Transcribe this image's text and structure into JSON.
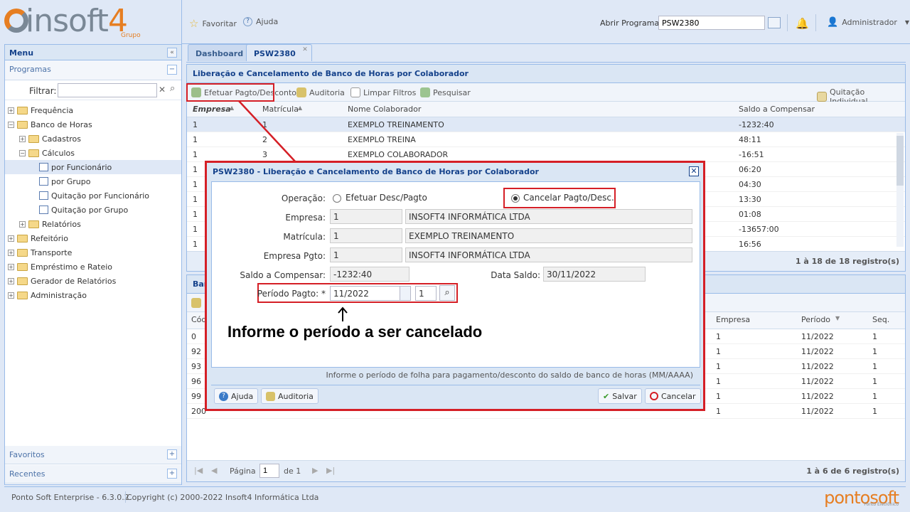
{
  "header": {
    "logo_text": "insoft",
    "logo_digit": "4",
    "logo_sub": "Grupo",
    "favorite_label": "Favoritar",
    "help_label": "Ajuda",
    "program_label": "Abrir Programa:",
    "program_value": "PSW2380",
    "user_label": "Administrador"
  },
  "sidebar": {
    "menu_title": "Menu",
    "programs_title": "Programas",
    "filter_label": "Filtrar:",
    "items": [
      {
        "label": "Frequência"
      },
      {
        "label": "Banco de Horas"
      },
      {
        "label": "Cadastros"
      },
      {
        "label": "Cálculos"
      },
      {
        "label": "por Funcionário"
      },
      {
        "label": "por Grupo"
      },
      {
        "label": "Quitação por Funcionário"
      },
      {
        "label": "Quitação por Grupo"
      },
      {
        "label": "Relatórios"
      },
      {
        "label": "Refeitório"
      },
      {
        "label": "Transporte"
      },
      {
        "label": "Empréstimo e Rateio"
      },
      {
        "label": "Gerador de Relatórios"
      },
      {
        "label": "Administração"
      }
    ],
    "favorites_title": "Favoritos",
    "recent_title": "Recentes"
  },
  "tabs": [
    {
      "label": "Dashboard"
    },
    {
      "label": "PSW2380"
    }
  ],
  "grid1": {
    "title": "Liberação e Cancelamento de Banco de Horas por Colaborador",
    "toolbar": {
      "pay": "Efetuar Pagto/Desconto",
      "audit": "Auditoria",
      "clear": "Limpar Filtros",
      "search": "Pesquisar",
      "individual": "Quitação Individual"
    },
    "columns": [
      "Empresa",
      "Matrícula",
      "Nome Colaborador",
      "Saldo a Compensar"
    ],
    "rows": [
      {
        "c1": "1",
        "c2": "1",
        "c3": "EXEMPLO TREINAMENTO",
        "c4": "-1232:40"
      },
      {
        "c1": "1",
        "c2": "2",
        "c3": "EXEMPLO TREINA",
        "c4": "48:11"
      },
      {
        "c1": "1",
        "c2": "3",
        "c3": "EXEMPLO COLABORADOR",
        "c4": "-16:51"
      },
      {
        "c1": "1",
        "c2": "",
        "c3": "",
        "c4": "06:20"
      },
      {
        "c1": "1",
        "c2": "",
        "c3": "",
        "c4": "04:30"
      },
      {
        "c1": "1",
        "c2": "",
        "c3": "",
        "c4": "13:30"
      },
      {
        "c1": "1",
        "c2": "",
        "c3": "",
        "c4": "01:08"
      },
      {
        "c1": "1",
        "c2": "",
        "c3": "",
        "c4": "-13657:00"
      },
      {
        "c1": "1",
        "c2": "",
        "c3": "",
        "c4": "16:56"
      }
    ],
    "pager_info": "1 à 18 de 18 registro(s)"
  },
  "grid2": {
    "title_prefix": "Ban",
    "columns": [
      "Cód",
      "Empresa",
      "Período",
      "Seq."
    ],
    "rows": [
      {
        "c1": "0",
        "c2": "1",
        "c3": "11/2022",
        "c4": "1"
      },
      {
        "c1": "92",
        "c2": "1",
        "c3": "11/2022",
        "c4": "1"
      },
      {
        "c1": "93",
        "c2": "1",
        "c3": "11/2022",
        "c4": "1"
      },
      {
        "c1": "96",
        "c2": "1",
        "c3": "11/2022",
        "c4": "1"
      },
      {
        "c1": "99",
        "c2": "1",
        "c3": "11/2022",
        "c4": "1"
      },
      {
        "c1": "200",
        "c2": "1",
        "c3": "11/2022",
        "c4": "1"
      }
    ],
    "page_label": "Página",
    "page_value": "1",
    "page_of": "de 1",
    "pager_info": "1 à 6 de 6 registro(s)"
  },
  "modal": {
    "title": "PSW2380 - Liberação e Cancelamento de Banco de Horas por Colaborador",
    "operation_label": "Operação:",
    "op1": "Efetuar Desc/Pagto",
    "op2": "Cancelar Pagto/Desc.",
    "empresa_label": "Empresa:",
    "empresa_code": "1",
    "empresa_name": "INSOFT4 INFORMÁTICA LTDA",
    "matricula_label": "Matrícula:",
    "matricula_code": "1",
    "matricula_name": "EXEMPLO TREINAMENTO",
    "empresa_pgto_label": "Empresa Pgto:",
    "empresa_pgto_code": "1",
    "empresa_pgto_name": "INSOFT4 INFORMÁTICA LTDA",
    "saldo_label": "Saldo a Compensar:",
    "saldo_value": "-1232:40",
    "data_saldo_label": "Data Saldo:",
    "data_saldo_value": "30/11/2022",
    "periodo_label": "Período Pagto: *",
    "periodo_value": "11/2022",
    "periodo_seq": "1",
    "hint": "Informe o período de folha para pagamento/desconto do saldo de banco de horas (MM/AAAA)",
    "help_btn": "Ajuda",
    "audit_btn": "Auditoria",
    "save_btn": "Salvar",
    "cancel_btn": "Cancelar"
  },
  "annotation": "Informe o período a ser cancelado",
  "status": {
    "version": "Ponto Soft Enterprise - 6.3.0.2",
    "copyright": "Copyright (c) 2000-2022 Insoft4 Informática Ltda",
    "brand": "pontosoft",
    "brand_sub": "Ponto Eletrônico"
  },
  "colors": {
    "accent": "#15428b",
    "highlight": "#d51f26",
    "orange": "#e67e22"
  }
}
